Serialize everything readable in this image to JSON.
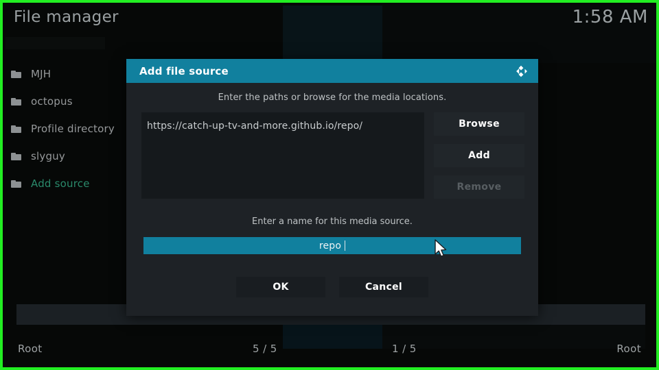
{
  "window": {
    "title": "File manager",
    "clock": "1:58 AM",
    "accent_color": "#11809e",
    "border_color": "#22ee22",
    "link_color": "#2a8a6b"
  },
  "sidebar": {
    "items": [
      {
        "label": "MJH",
        "icon": "folder-icon",
        "accent": false
      },
      {
        "label": "octopus",
        "icon": "folder-icon",
        "accent": false
      },
      {
        "label": "Profile directory",
        "icon": "folder-icon",
        "accent": false
      },
      {
        "label": "slyguy",
        "icon": "folder-icon",
        "accent": false
      },
      {
        "label": "Add source",
        "icon": "folder-icon",
        "accent": true
      }
    ]
  },
  "dialog": {
    "title": "Add file source",
    "logo_icon": "kodi-logo-icon",
    "paths_hint": "Enter the paths or browse for the media locations.",
    "paths": [
      "https://catch-up-tv-and-more.github.io/repo/"
    ],
    "buttons": {
      "browse": "Browse",
      "add": "Add",
      "remove": "Remove"
    },
    "name_hint": "Enter a name for this media source.",
    "name_value": "repo",
    "name_placeholder": "",
    "footer": {
      "ok": "OK",
      "cancel": "Cancel"
    }
  },
  "statusbar": {
    "left": "Root",
    "mid_left": "5 / 5",
    "mid_right": "1 / 5",
    "right": "Root"
  }
}
